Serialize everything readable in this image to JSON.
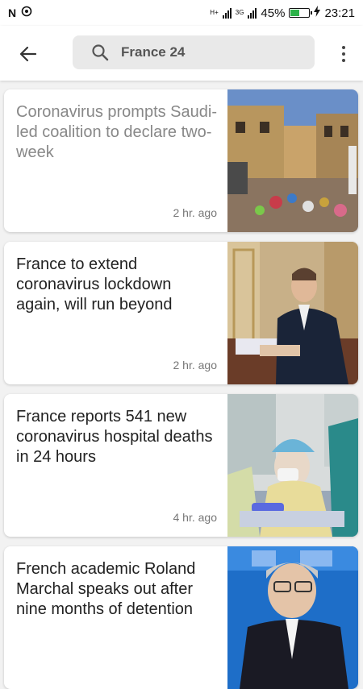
{
  "status_bar": {
    "carrier_icons": [
      "n-icon",
      "signal-circle-icon"
    ],
    "net1": "H+",
    "net2": "3G",
    "battery": "45%",
    "time": "23:21"
  },
  "toolbar": {
    "back_icon": "arrow-left-icon",
    "search_icon": "search-icon",
    "query": "France 24",
    "more_icon": "more-vert-icon"
  },
  "articles": [
    {
      "title": "Coronavirus prompts Saudi-led coalition to declare two-week",
      "time": "2 hr. ago",
      "visited": true
    },
    {
      "title": "France to extend coronavirus lockdown again, will run beyond",
      "time": "2 hr. ago",
      "visited": false
    },
    {
      "title": "France reports 541 new coronavirus hospital deaths in 24 hours",
      "time": "4 hr. ago",
      "visited": false
    },
    {
      "title": "French academic Roland Marchal speaks out after nine months of detention",
      "time": "",
      "visited": false
    }
  ],
  "colors": {
    "visited_title": "#888888",
    "title": "#222222",
    "battery": "#2db34a"
  }
}
